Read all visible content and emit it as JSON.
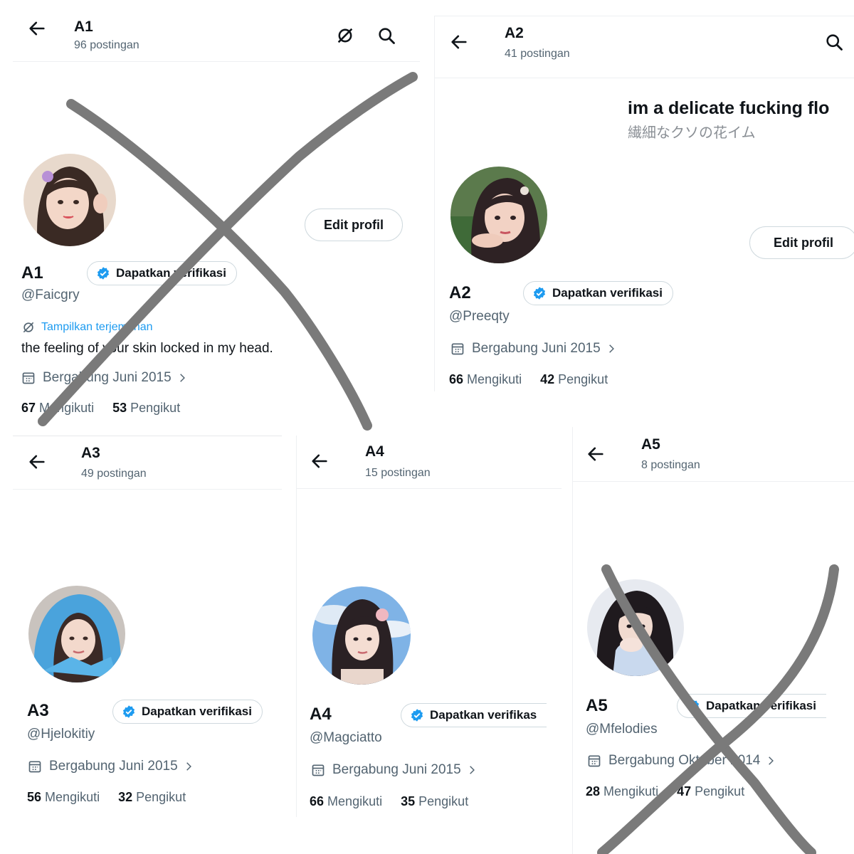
{
  "profiles": [
    {
      "name": "A1",
      "posts": "96 postingan",
      "handle": "@Faicgry",
      "translate": "Tampilkan terjemahan",
      "bio": "the feeling of your skin locked in my head.",
      "joined": "Bergabung Juni 2015",
      "following": "67",
      "following_label": "Mengikuti",
      "followers": "53",
      "followers_label": "Pengikut",
      "edit": "Edit profil",
      "verify": "Dapatkan verifikasi"
    },
    {
      "name": "A2",
      "posts": "41 postingan",
      "handle": "@Preeqty",
      "banner_text": "im a delicate fucking flo",
      "banner_sub": "繊細なクソの花イム",
      "joined": "Bergabung Juni 2015",
      "following": "66",
      "following_label": "Mengikuti",
      "followers": "42",
      "followers_label": "Pengikut",
      "edit": "Edit profil",
      "verify": "Dapatkan verifikasi"
    },
    {
      "name": "A3",
      "posts": "49 postingan",
      "handle": "@Hjelokitiy",
      "joined": "Bergabung Juni 2015",
      "following": "56",
      "following_label": "Mengikuti",
      "followers": "32",
      "followers_label": "Pengikut",
      "verify": "Dapatkan verifikasi"
    },
    {
      "name": "A4",
      "posts": "15 postingan",
      "handle": "@Magciatto",
      "joined": "Bergabung Juni 2015",
      "following": "66",
      "following_label": "Mengikuti",
      "followers": "35",
      "followers_label": "Pengikut",
      "verify": "Dapatkan verifikas"
    },
    {
      "name": "A5",
      "posts": "8 postingan",
      "handle": "@Mfelodies",
      "joined": "Bergabung Oktober 2014",
      "following": "28",
      "following_label": "Mengikuti",
      "followers": "47",
      "followers_label": "Pengikut",
      "verify": "Dapatkan verifikasi"
    }
  ],
  "icons": {
    "back": "arrow-left-icon",
    "search": "search-icon",
    "translate": "translate-icon",
    "calendar": "calendar-icon",
    "verified": "verified-badge-icon",
    "chevron": "chevron-right-icon"
  },
  "colors": {
    "verified": "#1d9bf0",
    "link": "#1d9bf0",
    "muted": "#536471",
    "cross": "#7a7a7a"
  }
}
